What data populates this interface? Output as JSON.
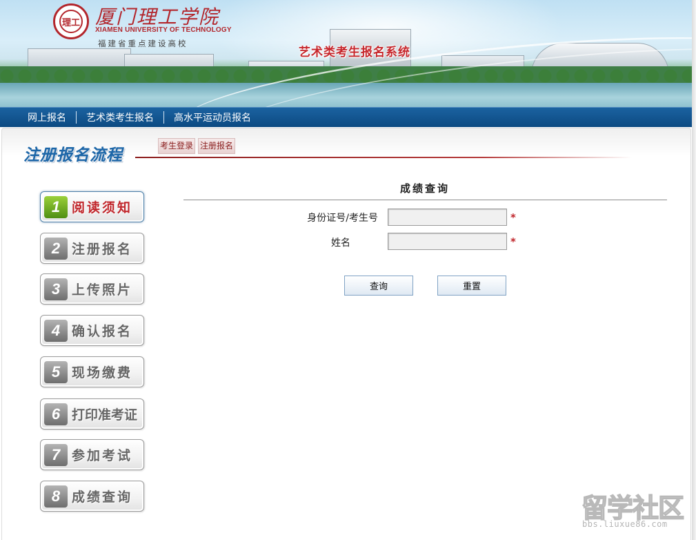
{
  "header": {
    "emblem_text": "理工",
    "school_name_cn": "厦门理工学院",
    "school_name_en": "XIAMEN UNIVERSITY OF TECHNOLOGY",
    "school_tagline": "福建省重点建设高校",
    "system_title": "艺术类考生报名系统"
  },
  "nav": {
    "items": [
      {
        "label": "网上报名"
      },
      {
        "label": "艺术类考生报名"
      },
      {
        "label": "高水平运动员报名"
      }
    ]
  },
  "flow": {
    "title": "注册报名流程",
    "tabs": [
      {
        "label": "考生登录"
      },
      {
        "label": "注册报名"
      }
    ]
  },
  "steps": [
    {
      "num": "1",
      "label": "阅读须知",
      "active": true
    },
    {
      "num": "2",
      "label": "注册报名"
    },
    {
      "num": "3",
      "label": "上传照片"
    },
    {
      "num": "4",
      "label": "确认报名"
    },
    {
      "num": "5",
      "label": "现场缴费"
    },
    {
      "num": "6",
      "label": "打印准考证"
    },
    {
      "num": "7",
      "label": "参加考试"
    },
    {
      "num": "8",
      "label": "成绩查询"
    }
  ],
  "form": {
    "title": "成绩查询",
    "fields": [
      {
        "label": "身份证号/考生号",
        "value": "",
        "required_mark": "*"
      },
      {
        "label": "姓名",
        "value": "",
        "required_mark": "*"
      }
    ],
    "submit_label": "查询",
    "reset_label": "重置"
  },
  "watermark": {
    "text": "留学社区",
    "url_text": "bbs.liuxue86.com"
  },
  "colors": {
    "nav_blue": "#0c4a82",
    "brand_red": "#b3262c",
    "flow_title_blue": "#1c66a8",
    "active_step_green": "#4f8f12"
  }
}
